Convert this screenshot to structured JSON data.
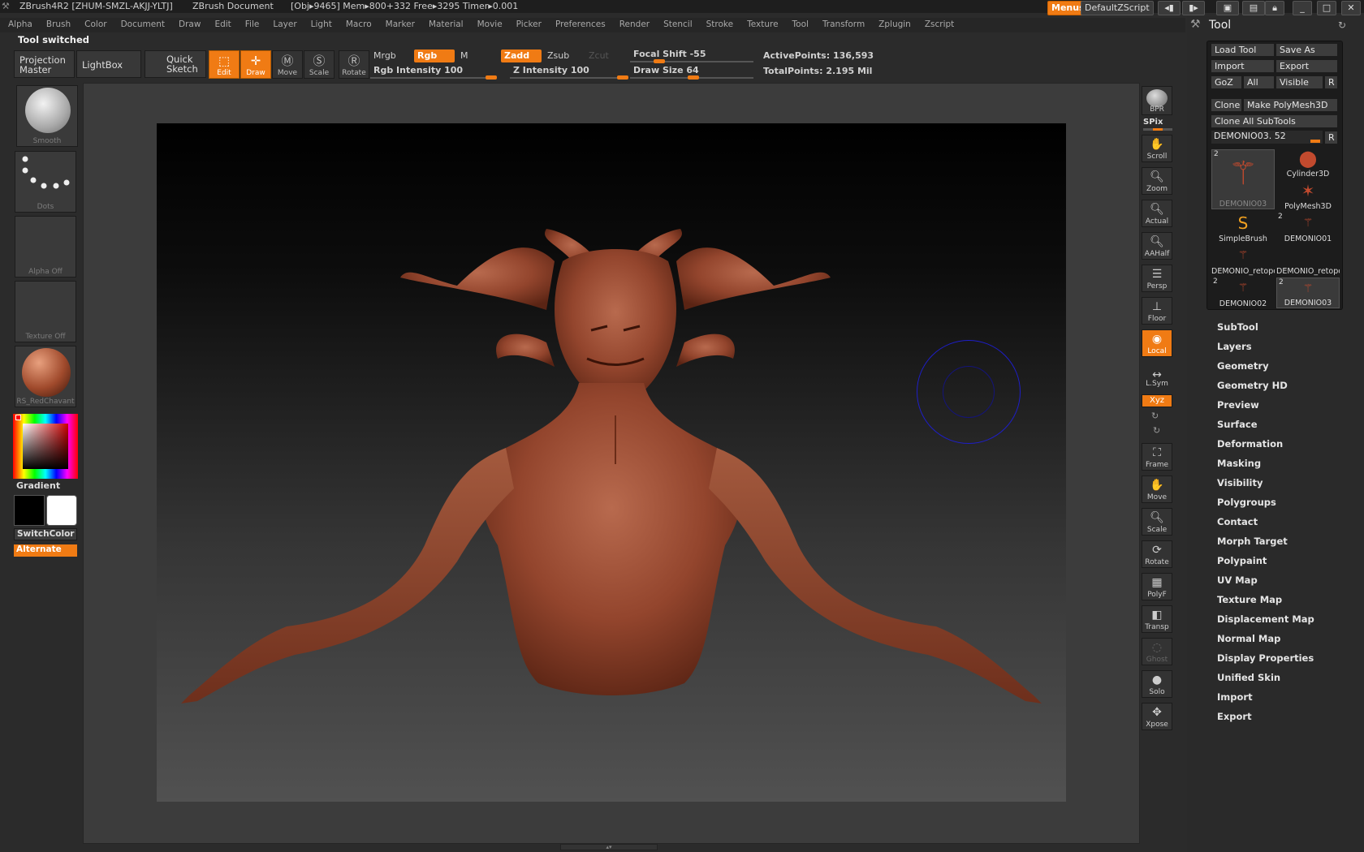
{
  "titlebar": {
    "app": "ZBrush4R2 [ZHUM-SMZL-AKJJ-YLTJ]",
    "document": "ZBrush Document",
    "stats": "[Obj▸9465] Mem▸800+332 Free▸3295 Timer▸0.001",
    "menus_button": "Menus",
    "script_button": "DefaultZScript"
  },
  "menubar": {
    "items": [
      "Alpha",
      "Brush",
      "Color",
      "Document",
      "Draw",
      "Edit",
      "File",
      "Layer",
      "Light",
      "Macro",
      "Marker",
      "Material",
      "Movie",
      "Picker",
      "Preferences",
      "Render",
      "Stencil",
      "Stroke",
      "Texture",
      "Tool",
      "Transform",
      "Zplugin",
      "Zscript"
    ]
  },
  "status": "Tool switched",
  "toolbar": {
    "projection_master": "Projection Master",
    "lightbox": "LightBox",
    "quick_sketch": "Quick Sketch",
    "edit": "Edit",
    "draw": "Draw",
    "move": "Move",
    "scale": "Scale",
    "rotate": "Rotate",
    "mrgb": "Mrgb",
    "rgb": "Rgb",
    "m": "M",
    "zadd": "Zadd",
    "zsub": "Zsub",
    "zcut": "Zcut",
    "rgb_intensity_label": "Rgb Intensity",
    "rgb_intensity": "100",
    "z_intensity_label": "Z Intensity",
    "z_intensity": "100",
    "focal_shift_label": "Focal Shift",
    "focal_shift": "-55",
    "draw_size_label": "Draw Size",
    "draw_size": "64",
    "active_points_label": "ActivePoints:",
    "active_points": "136,593",
    "total_points_label": "TotalPoints:",
    "total_points": "2.195 Mil"
  },
  "left_shelf": {
    "brush": "Smooth",
    "stroke": "Dots",
    "alpha": "Alpha Off",
    "texture": "Texture Off",
    "material": "RS_RedChavant",
    "gradient": "Gradient",
    "switch_color": "SwitchColor",
    "alternate": "Alternate"
  },
  "right_shelf": {
    "buttons": [
      "BPR",
      "SPix",
      "Scroll",
      "Zoom",
      "Actual",
      "AAHalf",
      "Persp",
      "Floor",
      "Local",
      "L.Sym",
      "Xyz",
      "Frame",
      "Move",
      "Scale",
      "Rotate",
      "PolyF",
      "Transp",
      "Ghost",
      "Solo",
      "Xpose"
    ]
  },
  "tool_panel": {
    "title": "Tool",
    "load_tool": "Load Tool",
    "save_as": "Save As",
    "import": "Import",
    "export": "Export",
    "goz": "GoZ",
    "all": "All",
    "visible": "Visible",
    "r": "R",
    "clone": "Clone",
    "make_polymesh": "Make PolyMesh3D",
    "clone_all": "Clone All SubTools",
    "current_tool": "DEMONIO03. 52",
    "tools": [
      {
        "name": "DEMONIO03",
        "count": "2"
      },
      {
        "name": "Cylinder3D",
        "count": ""
      },
      {
        "name": "PolyMesh3D",
        "count": ""
      },
      {
        "name": "SimpleBrush",
        "count": ""
      },
      {
        "name": "DEMONIO01",
        "count": "2"
      },
      {
        "name": "DEMONIO_retopo",
        "count": ""
      },
      {
        "name": "DEMONIO_retopo",
        "count": ""
      },
      {
        "name": "DEMONIO02",
        "count": "2"
      },
      {
        "name": "DEMONIO03",
        "count": "2"
      }
    ],
    "subpalettes": [
      "SubTool",
      "Layers",
      "Geometry",
      "Geometry HD",
      "Preview",
      "Surface",
      "Deformation",
      "Masking",
      "Visibility",
      "Polygroups",
      "Contact",
      "Morph Target",
      "Polypaint",
      "UV Map",
      "Texture Map",
      "Displacement Map",
      "Normal Map",
      "Display Properties",
      "Unified Skin",
      "Import",
      "Export"
    ]
  },
  "colors": {
    "accent": "#f07b14",
    "model": "#9a4a32"
  }
}
